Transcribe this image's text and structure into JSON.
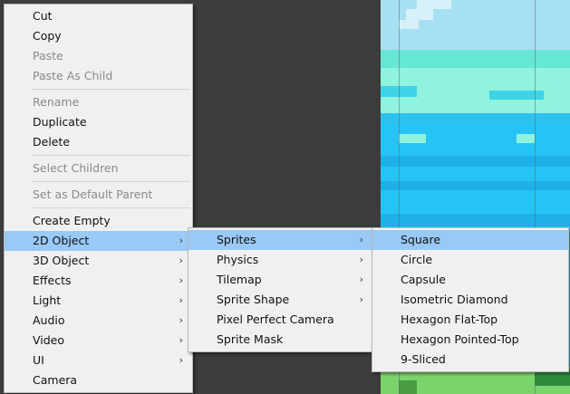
{
  "main_menu": [
    {
      "label": "Cut"
    },
    {
      "label": "Copy"
    },
    {
      "label": "Paste",
      "disabled": true
    },
    {
      "label": "Paste As Child",
      "disabled": true
    },
    {
      "separator": true
    },
    {
      "label": "Rename",
      "disabled": true
    },
    {
      "label": "Duplicate"
    },
    {
      "label": "Delete"
    },
    {
      "separator": true
    },
    {
      "label": "Select Children",
      "disabled": true
    },
    {
      "separator": true
    },
    {
      "label": "Set as Default Parent",
      "disabled": true
    },
    {
      "separator": true
    },
    {
      "label": "Create Empty"
    },
    {
      "label": "2D Object",
      "submenu": true,
      "highlighted": true
    },
    {
      "label": "3D Object",
      "submenu": true
    },
    {
      "label": "Effects",
      "submenu": true
    },
    {
      "label": "Light",
      "submenu": true
    },
    {
      "label": "Audio",
      "submenu": true
    },
    {
      "label": "Video",
      "submenu": true
    },
    {
      "label": "UI",
      "submenu": true
    },
    {
      "label": "Camera"
    }
  ],
  "submenu_2d": [
    {
      "label": "Sprites",
      "submenu": true,
      "highlighted": true
    },
    {
      "label": "Physics",
      "submenu": true
    },
    {
      "label": "Tilemap",
      "submenu": true
    },
    {
      "label": "Sprite Shape",
      "submenu": true
    },
    {
      "label": "Pixel Perfect Camera"
    },
    {
      "label": "Sprite Mask"
    }
  ],
  "submenu_sprites": [
    {
      "label": "Square",
      "highlighted": true
    },
    {
      "label": "Circle"
    },
    {
      "label": "Capsule"
    },
    {
      "label": "Isometric Diamond"
    },
    {
      "label": "Hexagon Flat-Top"
    },
    {
      "label": "Hexagon Pointed-Top"
    },
    {
      "label": "9-Sliced"
    }
  ],
  "colors": {
    "menu_bg": "#f0f0f0",
    "highlight": "#99c9f5",
    "disabled_text": "#8a8a8a",
    "scene_water": "#27c3f4",
    "scene_sky": "#a7dff2",
    "scene_grass": "#7bd36b"
  },
  "icons": {
    "submenu_arrow": "chevron-right-icon"
  }
}
